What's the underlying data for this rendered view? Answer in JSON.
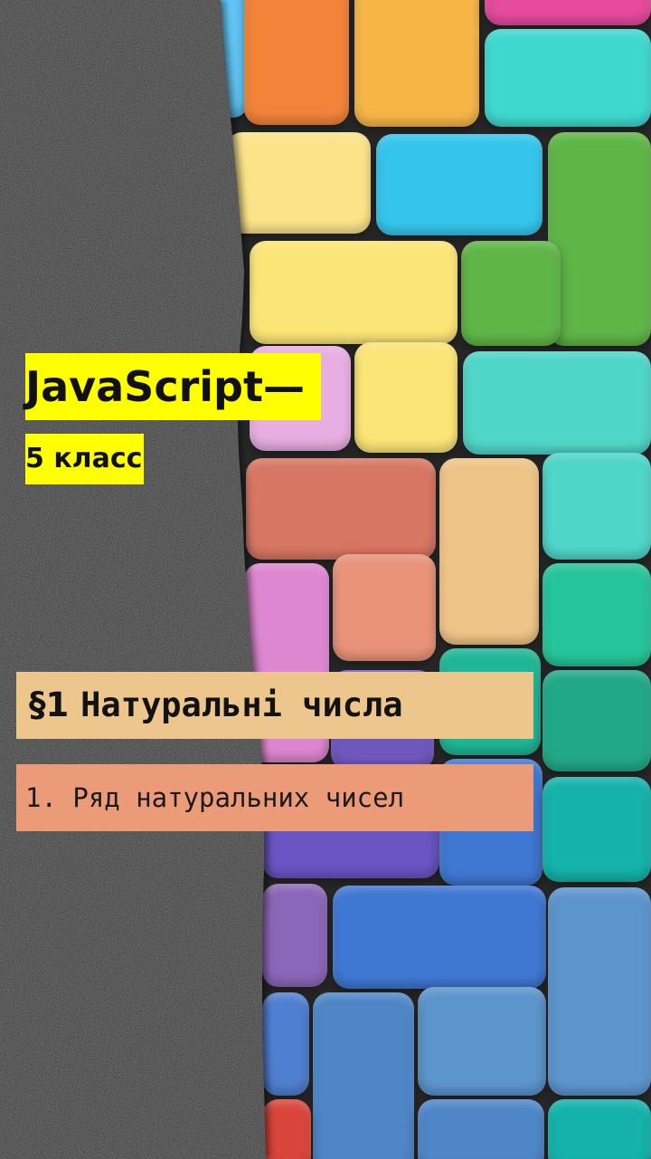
{
  "slide": {
    "title": "JavaScript—",
    "subtitle": "5 класс",
    "section_number": "§1",
    "section_title": "Натуральні числа",
    "lesson": "1. Ряд натуральних чисел"
  },
  "colors": {
    "title_highlight": "#ffff00",
    "section_box": "#ecc68c",
    "lesson_box": "#ec9b79",
    "chalkboard": "#1b1b1b"
  },
  "background": {
    "left_panel": "chalkboard-texture",
    "right_panel": "colorful-3d-block-tiles"
  }
}
